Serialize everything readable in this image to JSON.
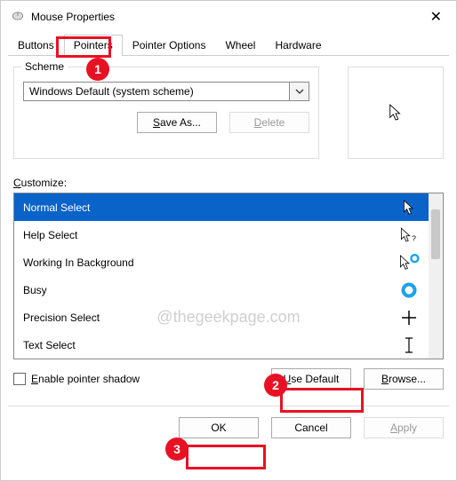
{
  "window": {
    "title": "Mouse Properties"
  },
  "tabs": {
    "buttons": "Buttons",
    "pointers": "Pointers",
    "pointer_options": "Pointer Options",
    "wheel": "Wheel",
    "hardware": "Hardware"
  },
  "scheme": {
    "legend": "Scheme",
    "value": "Windows Default (system scheme)",
    "save_as": "Save As...",
    "delete": "Delete"
  },
  "customize": {
    "label": "Customize:",
    "items": [
      {
        "name": "Normal Select",
        "icon": "cursor-arrow"
      },
      {
        "name": "Help Select",
        "icon": "cursor-help"
      },
      {
        "name": "Working In Background",
        "icon": "cursor-working"
      },
      {
        "name": "Busy",
        "icon": "cursor-busy"
      },
      {
        "name": "Precision Select",
        "icon": "cursor-cross"
      },
      {
        "name": "Text Select",
        "icon": "cursor-ibeam"
      }
    ]
  },
  "shadow": {
    "label": "Enable pointer shadow"
  },
  "buttons": {
    "use_default": "Use Default",
    "browse": "Browse...",
    "ok": "OK",
    "cancel": "Cancel",
    "apply": "Apply"
  },
  "annotations": {
    "badge1": "1",
    "badge2": "2",
    "badge3": "3"
  },
  "watermark": "@thegeekpage.com"
}
